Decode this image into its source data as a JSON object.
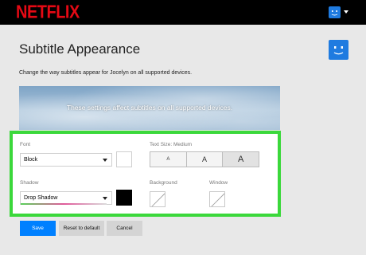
{
  "header": {
    "logo": "NETFLIX",
    "logo_color": "#e50914",
    "avatar_icon": "profile-avatar-icon",
    "menu_icon": "caret-down-icon"
  },
  "page": {
    "title": "Subtitle Appearance",
    "description": "Change the way subtitles appear for Jocelyn on all supported devices.",
    "preview_text": "These settings affect subtitles on all supported devices."
  },
  "settings": {
    "font_label": "Font",
    "font_value": "Block",
    "text_size_label": "Text Size: Medium",
    "text_size_options": [
      "A",
      "A",
      "A"
    ],
    "text_size_selected": "Medium",
    "shadow_label": "Shadow",
    "shadow_value": "Drop Shadow",
    "background_label": "Background",
    "window_label": "Window",
    "font_color": "#ffffff",
    "shadow_color": "#000000",
    "highlight_color": "#3bd83b"
  },
  "actions": {
    "save": "Save",
    "reset": "Reset to default",
    "cancel": "Cancel",
    "save_color": "#0080ff"
  }
}
